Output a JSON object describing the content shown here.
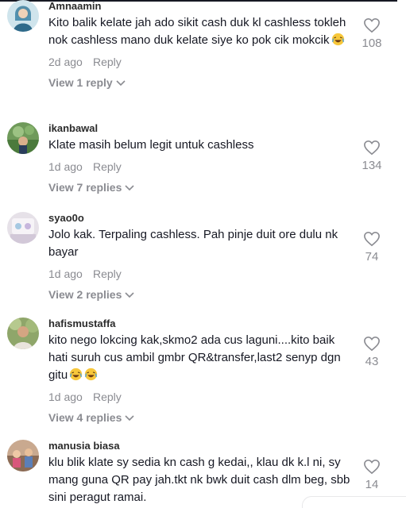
{
  "comments": [
    {
      "username": "Amnaamin",
      "text": "Kito balik kelate jah ado sikit cash duk kl cashless tokleh nok cashless mano duk kelate siye ko pok cik mokcik",
      "time": "2d ago",
      "reply": "Reply",
      "view_replies": "View 1 reply",
      "likes": "108"
    },
    {
      "username": "ikanbawal",
      "text": "Klate masih belum legit untuk cashless",
      "time": "1d ago",
      "reply": "Reply",
      "view_replies": "View 7 replies",
      "likes": "134"
    },
    {
      "username": "syao0o",
      "text": "Jolo kak. Terpaling cashless. Pah pinje duit ore dulu nk bayar",
      "time": "1d ago",
      "reply": "Reply",
      "view_replies": "View 2 replies",
      "likes": "74"
    },
    {
      "username": "hafismustaffa",
      "text": "kito nego lokcing kak,skmo2 ada cus laguni....kito baik hati suruh cus ambil gmbr QR&transfer,last2 senyp dgn gitu",
      "time": "1d ago",
      "reply": "Reply",
      "view_replies": "View 4 replies",
      "likes": "43"
    },
    {
      "username": "manusia biasa",
      "text": "klu blik klate sy sedia kn cash g kedai,, klau dk k.l ni, sy mang guna QR pay jah.tkt nk bwk duit cash dlm beg, sbb sini peragut ramai.",
      "likes": "14"
    }
  ],
  "colors": {
    "text": "#161823",
    "muted": "#8a8b91",
    "username": "#2b2b2b",
    "emoji": "#f7c73b"
  }
}
